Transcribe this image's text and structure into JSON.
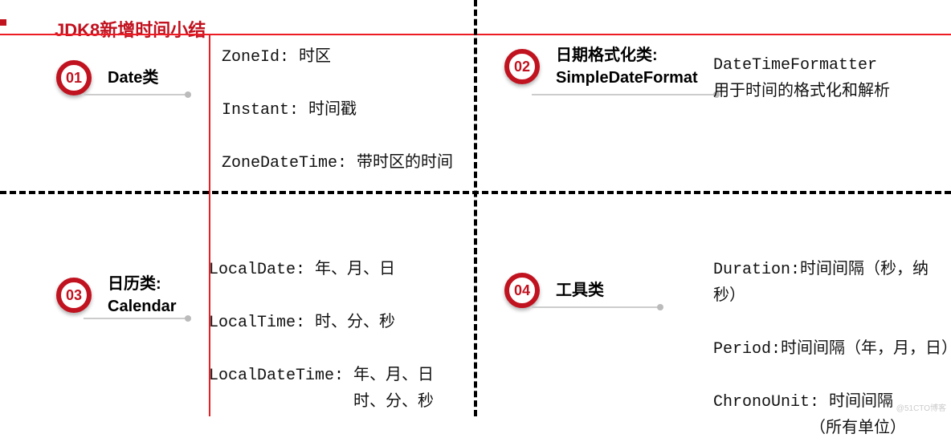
{
  "title": "JDK8新增时间小结",
  "q1": {
    "num": "01",
    "label": "Date类",
    "line1": "ZoneId: 时区",
    "line2": "Instant: 时间戳",
    "line3": "ZoneDateTime: 带时区的时间"
  },
  "q2": {
    "num": "02",
    "label1": "日期格式化类:",
    "label2": "SimpleDateFormat",
    "line1": "DateTimeFormatter",
    "line2": "用于时间的格式化和解析"
  },
  "q3": {
    "num": "03",
    "label1": "日历类:",
    "label2": "Calendar",
    "line1": "LocalDate: 年、月、日",
    "line2": "LocalTime: 时、分、秒",
    "line3": "LocalDateTime: 年、月、日",
    "line4": "               时、分、秒"
  },
  "q4": {
    "num": "04",
    "label": "工具类",
    "line1": "Duration:时间间隔（秒，纳秒）",
    "line2": "Period:时间间隔（年，月，日）",
    "line3": "ChronoUnit: 时间间隔",
    "line4": "          （所有单位）"
  },
  "watermark": "@51CTO博客"
}
